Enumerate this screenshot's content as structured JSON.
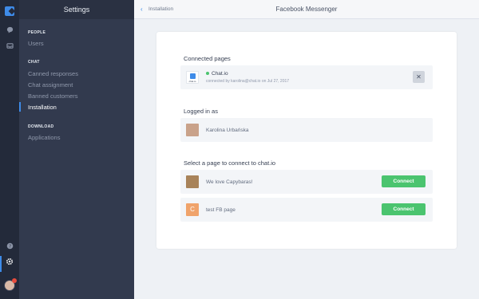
{
  "settings": {
    "title": "Settings",
    "sections": [
      {
        "header": "PEOPLE",
        "items": [
          "Users"
        ]
      },
      {
        "header": "CHAT",
        "items": [
          "Canned responses",
          "Chat assignment",
          "Banned customers",
          "Installation"
        ]
      },
      {
        "header": "DOWNLOAD",
        "items": [
          "Applications"
        ]
      }
    ],
    "active_item": "Installation"
  },
  "topbar": {
    "back_label": "Installation",
    "title": "Facebook Messenger"
  },
  "connected": {
    "heading": "Connected pages",
    "page_name": "Chat.io",
    "page_meta": "connected by karolina@chat.io on Jul 27, 2017",
    "logo_text": "chat.io"
  },
  "logged_in": {
    "heading": "Logged in as",
    "name": "Karolina Urbańska"
  },
  "select": {
    "heading": "Select a page to connect to chat.io",
    "pages": [
      {
        "name": "We love Capybaras!",
        "button": "Connect"
      },
      {
        "name": "test FB page",
        "button": "Connect",
        "letter": "C"
      }
    ]
  },
  "colors": {
    "accent": "#3e8be8",
    "connect_green": "#4bc46f",
    "sidebar": "#323a4e",
    "rail": "#232a3a"
  },
  "icons": [
    "chat-bubble-icon",
    "inbox-icon",
    "help-icon",
    "gear-icon",
    "close-icon",
    "chevron-left-icon"
  ]
}
